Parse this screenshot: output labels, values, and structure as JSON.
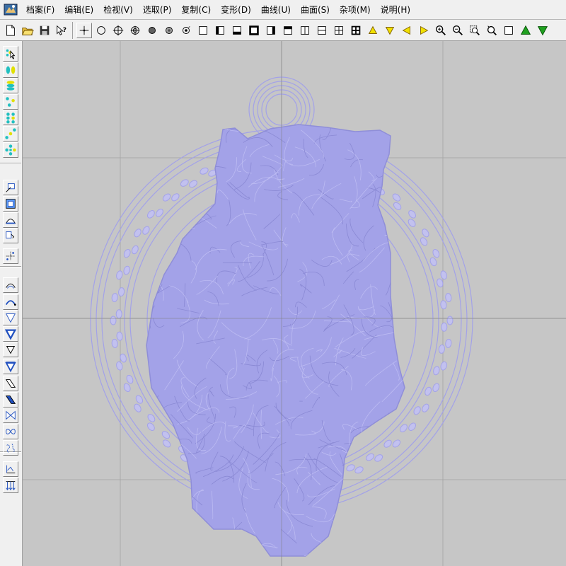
{
  "menu": [
    {
      "label": "档案(F)"
    },
    {
      "label": "编辑(E)"
    },
    {
      "label": "检视(V)"
    },
    {
      "label": "选取(P)"
    },
    {
      "label": "复制(C)"
    },
    {
      "label": "变形(D)"
    },
    {
      "label": "曲线(U)"
    },
    {
      "label": "曲面(S)"
    },
    {
      "label": "杂项(M)"
    },
    {
      "label": "说明(H)"
    }
  ],
  "toolbar_icons": [
    "new-file-icon",
    "open-folder-icon",
    "save-icon",
    "help-cursor-icon",
    "point-icon",
    "circle-icon",
    "crosshair-circle-icon",
    "target-icon",
    "solid-dot-icon",
    "shaded-dot-icon",
    "rotate-dot-icon",
    "view-single-icon",
    "view-left-icon",
    "view-bottom-icon",
    "view-thick-icon",
    "view-right-icon",
    "view-top-icon",
    "split-vertical-icon",
    "split-horizontal-icon",
    "grid-four-icon",
    "grid-four-bold-icon",
    "arrow-up-icon",
    "arrow-down-icon",
    "arrow-left-icon",
    "arrow-right-icon",
    "zoom-in-icon",
    "zoom-out-icon",
    "zoom-window-icon",
    "zoom-dynamic-icon",
    "zoom-extents-icon",
    "view-up-green-icon",
    "view-down-green-icon"
  ],
  "left_toolbar_icons": [
    "select-pointer-icon",
    "select-pair-icon",
    "select-stack-icon",
    "select-scatter-icon",
    "select-grid-icon",
    "select-diagonal-icon",
    "select-cluster-icon",
    "line-rect-icon",
    "frame-rect-icon",
    "arc-shape-icon",
    "copy-shape-icon",
    "point-snap-icon",
    "curve-arc-icon",
    "curve-arc-bold-icon",
    "triangle-down-icon",
    "triangle-down-bold-icon",
    "triangle-down-small-icon",
    "triangle-down-filled-icon",
    "parallelogram-icon",
    "parallelogram-bold-icon",
    "bowtie-icon",
    "infinity-icon",
    "wave-icon",
    "axis-arrow-icon",
    "vector-down-icon"
  ],
  "viewport": {
    "background": "#c6c6c6",
    "wire_color": "#a3a2e8",
    "grid_color": "#a9a9a9",
    "axis_color": "#808080",
    "model": "tiger-pendant-wireframe"
  }
}
